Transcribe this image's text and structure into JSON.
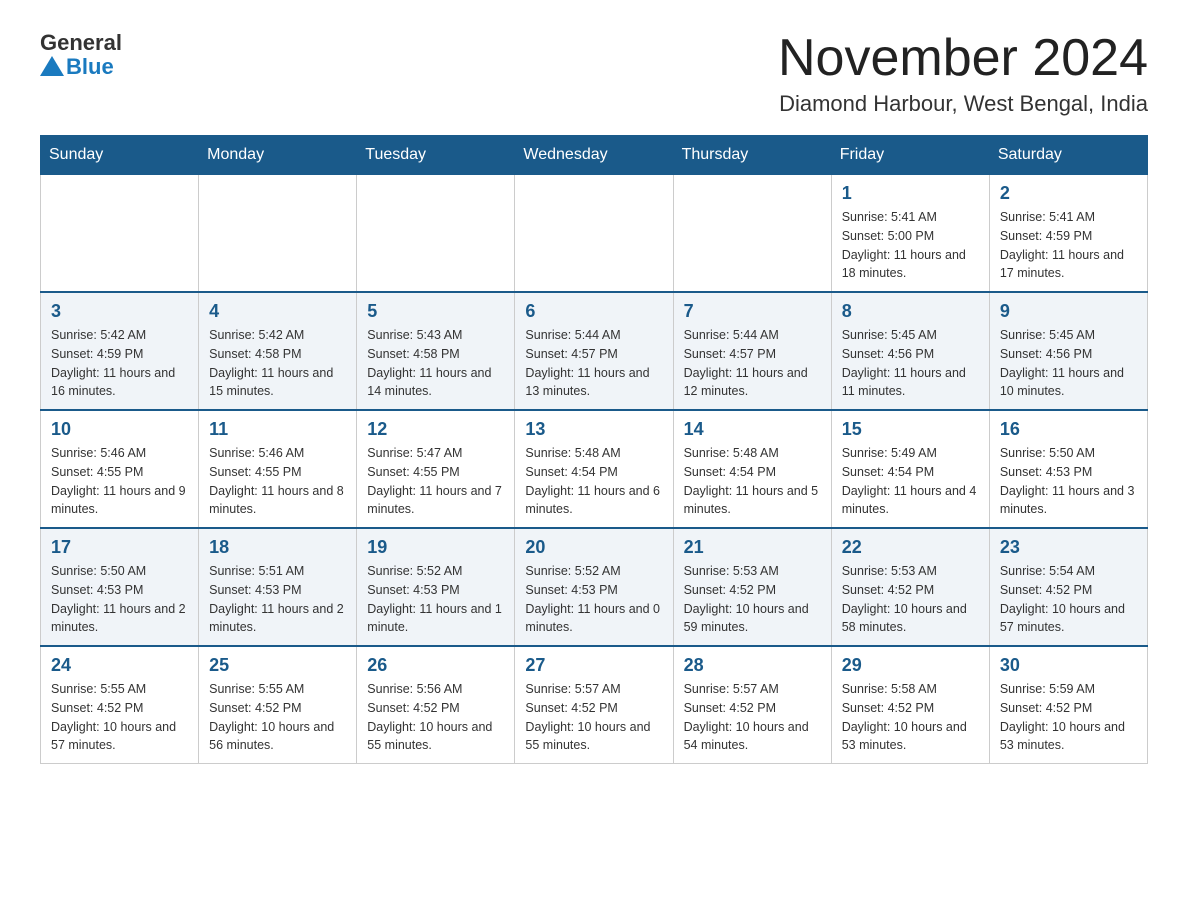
{
  "header": {
    "logo_general": "General",
    "logo_blue": "Blue",
    "title": "November 2024",
    "subtitle": "Diamond Harbour, West Bengal, India"
  },
  "days_of_week": [
    "Sunday",
    "Monday",
    "Tuesday",
    "Wednesday",
    "Thursday",
    "Friday",
    "Saturday"
  ],
  "weeks": [
    {
      "days": [
        {
          "num": "",
          "info": ""
        },
        {
          "num": "",
          "info": ""
        },
        {
          "num": "",
          "info": ""
        },
        {
          "num": "",
          "info": ""
        },
        {
          "num": "",
          "info": ""
        },
        {
          "num": "1",
          "info": "Sunrise: 5:41 AM\nSunset: 5:00 PM\nDaylight: 11 hours and 18 minutes."
        },
        {
          "num": "2",
          "info": "Sunrise: 5:41 AM\nSunset: 4:59 PM\nDaylight: 11 hours and 17 minutes."
        }
      ]
    },
    {
      "days": [
        {
          "num": "3",
          "info": "Sunrise: 5:42 AM\nSunset: 4:59 PM\nDaylight: 11 hours and 16 minutes."
        },
        {
          "num": "4",
          "info": "Sunrise: 5:42 AM\nSunset: 4:58 PM\nDaylight: 11 hours and 15 minutes."
        },
        {
          "num": "5",
          "info": "Sunrise: 5:43 AM\nSunset: 4:58 PM\nDaylight: 11 hours and 14 minutes."
        },
        {
          "num": "6",
          "info": "Sunrise: 5:44 AM\nSunset: 4:57 PM\nDaylight: 11 hours and 13 minutes."
        },
        {
          "num": "7",
          "info": "Sunrise: 5:44 AM\nSunset: 4:57 PM\nDaylight: 11 hours and 12 minutes."
        },
        {
          "num": "8",
          "info": "Sunrise: 5:45 AM\nSunset: 4:56 PM\nDaylight: 11 hours and 11 minutes."
        },
        {
          "num": "9",
          "info": "Sunrise: 5:45 AM\nSunset: 4:56 PM\nDaylight: 11 hours and 10 minutes."
        }
      ]
    },
    {
      "days": [
        {
          "num": "10",
          "info": "Sunrise: 5:46 AM\nSunset: 4:55 PM\nDaylight: 11 hours and 9 minutes."
        },
        {
          "num": "11",
          "info": "Sunrise: 5:46 AM\nSunset: 4:55 PM\nDaylight: 11 hours and 8 minutes."
        },
        {
          "num": "12",
          "info": "Sunrise: 5:47 AM\nSunset: 4:55 PM\nDaylight: 11 hours and 7 minutes."
        },
        {
          "num": "13",
          "info": "Sunrise: 5:48 AM\nSunset: 4:54 PM\nDaylight: 11 hours and 6 minutes."
        },
        {
          "num": "14",
          "info": "Sunrise: 5:48 AM\nSunset: 4:54 PM\nDaylight: 11 hours and 5 minutes."
        },
        {
          "num": "15",
          "info": "Sunrise: 5:49 AM\nSunset: 4:54 PM\nDaylight: 11 hours and 4 minutes."
        },
        {
          "num": "16",
          "info": "Sunrise: 5:50 AM\nSunset: 4:53 PM\nDaylight: 11 hours and 3 minutes."
        }
      ]
    },
    {
      "days": [
        {
          "num": "17",
          "info": "Sunrise: 5:50 AM\nSunset: 4:53 PM\nDaylight: 11 hours and 2 minutes."
        },
        {
          "num": "18",
          "info": "Sunrise: 5:51 AM\nSunset: 4:53 PM\nDaylight: 11 hours and 2 minutes."
        },
        {
          "num": "19",
          "info": "Sunrise: 5:52 AM\nSunset: 4:53 PM\nDaylight: 11 hours and 1 minute."
        },
        {
          "num": "20",
          "info": "Sunrise: 5:52 AM\nSunset: 4:53 PM\nDaylight: 11 hours and 0 minutes."
        },
        {
          "num": "21",
          "info": "Sunrise: 5:53 AM\nSunset: 4:52 PM\nDaylight: 10 hours and 59 minutes."
        },
        {
          "num": "22",
          "info": "Sunrise: 5:53 AM\nSunset: 4:52 PM\nDaylight: 10 hours and 58 minutes."
        },
        {
          "num": "23",
          "info": "Sunrise: 5:54 AM\nSunset: 4:52 PM\nDaylight: 10 hours and 57 minutes."
        }
      ]
    },
    {
      "days": [
        {
          "num": "24",
          "info": "Sunrise: 5:55 AM\nSunset: 4:52 PM\nDaylight: 10 hours and 57 minutes."
        },
        {
          "num": "25",
          "info": "Sunrise: 5:55 AM\nSunset: 4:52 PM\nDaylight: 10 hours and 56 minutes."
        },
        {
          "num": "26",
          "info": "Sunrise: 5:56 AM\nSunset: 4:52 PM\nDaylight: 10 hours and 55 minutes."
        },
        {
          "num": "27",
          "info": "Sunrise: 5:57 AM\nSunset: 4:52 PM\nDaylight: 10 hours and 55 minutes."
        },
        {
          "num": "28",
          "info": "Sunrise: 5:57 AM\nSunset: 4:52 PM\nDaylight: 10 hours and 54 minutes."
        },
        {
          "num": "29",
          "info": "Sunrise: 5:58 AM\nSunset: 4:52 PM\nDaylight: 10 hours and 53 minutes."
        },
        {
          "num": "30",
          "info": "Sunrise: 5:59 AM\nSunset: 4:52 PM\nDaylight: 10 hours and 53 minutes."
        }
      ]
    }
  ]
}
